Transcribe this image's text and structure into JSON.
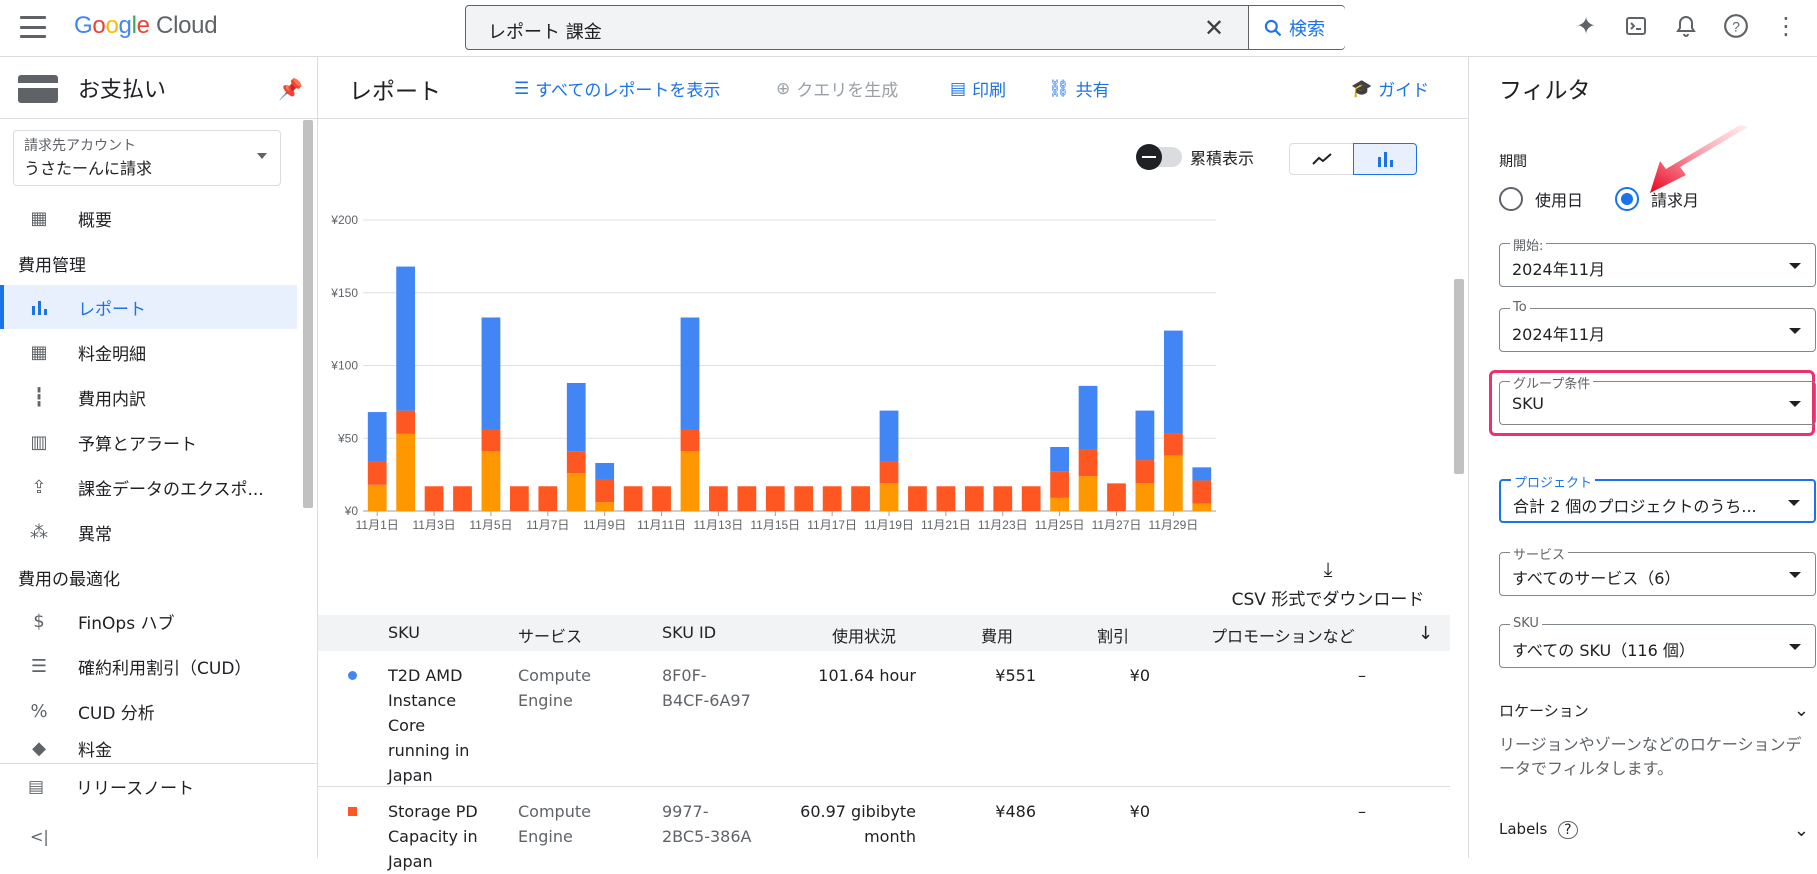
{
  "header": {
    "logo_google": "Google",
    "logo_cloud": "Cloud",
    "search_query": "レポート 課金",
    "search_button": "検索",
    "icons": [
      "gemini-icon",
      "terminal-icon",
      "bell-icon",
      "help-icon",
      "more-vert-icon"
    ]
  },
  "sidebar": {
    "title": "お支払い",
    "account_label": "請求先アカウント",
    "account_value": "うさたーんに請求",
    "items": [
      {
        "label": "概要",
        "icon": "dashboard-icon"
      },
      {
        "section": "費用管理"
      },
      {
        "label": "レポート",
        "icon": "bar-chart-icon",
        "active": true
      },
      {
        "label": "料金明細",
        "icon": "table-icon"
      },
      {
        "label": "費用内訳",
        "icon": "waterfall-icon"
      },
      {
        "label": "予算とアラート",
        "icon": "budget-icon"
      },
      {
        "label": "課金データのエクスポ...",
        "icon": "export-icon"
      },
      {
        "label": "異常",
        "icon": "anomaly-icon"
      },
      {
        "section": "費用の最適化"
      },
      {
        "label": "FinOps ハブ",
        "icon": "dollar-icon"
      },
      {
        "label": "確約利用割引（CUD）",
        "icon": "list-icon"
      },
      {
        "label": "CUD 分析",
        "icon": "percent-icon"
      },
      {
        "label": "料金",
        "icon": "tag-icon"
      }
    ],
    "footer": "リリースノート",
    "collapse": "<|"
  },
  "main": {
    "title": "レポート",
    "actions": {
      "all_reports": "すべてのレポートを表示",
      "query": "クエリを生成",
      "print": "印刷",
      "share": "共有",
      "guide": "ガイド"
    },
    "cumulative_label": "累積表示",
    "csv_label": "CSV 形式でダウンロード"
  },
  "chart_data": {
    "type": "bar",
    "stacked": true,
    "y_ticks": [
      "¥200",
      "¥150",
      "¥100",
      "¥50",
      "¥0"
    ],
    "ylim": [
      0,
      200
    ],
    "x_tick_labels": [
      "11月1日",
      "11月3日",
      "11月5日",
      "11月7日",
      "11月9日",
      "11月11日",
      "11月13日",
      "11月15日",
      "11月17日",
      "11月19日",
      "11月21日",
      "11月23日",
      "11月25日",
      "11月27日",
      "11月29日"
    ],
    "categories": [
      "1",
      "2",
      "3",
      "4",
      "5",
      "6",
      "7",
      "8",
      "9",
      "10",
      "11",
      "12",
      "13",
      "14",
      "15",
      "16",
      "17",
      "18",
      "19",
      "20",
      "21",
      "22",
      "23",
      "24",
      "25",
      "26",
      "27",
      "28",
      "29",
      "30"
    ],
    "colors": [
      "#ff9800",
      "#ff5722",
      "#4285f4"
    ],
    "series": [
      {
        "values": [
          18,
          53,
          0,
          0,
          41,
          0,
          0,
          26,
          6,
          0,
          0,
          41,
          0,
          0,
          0,
          0,
          0,
          0,
          19,
          0,
          0,
          0,
          0,
          0,
          9,
          24,
          0,
          19,
          38,
          5
        ]
      },
      {
        "values": [
          16,
          16,
          17,
          17,
          15,
          17,
          17,
          15,
          16,
          17,
          17,
          15,
          17,
          17,
          17,
          17,
          17,
          17,
          15,
          17,
          17,
          17,
          17,
          17,
          18,
          18,
          19,
          16,
          15,
          16
        ]
      },
      {
        "values": [
          34,
          99,
          0,
          0,
          77,
          0,
          0,
          47,
          11,
          0,
          0,
          77,
          0,
          0,
          0,
          0,
          0,
          0,
          35,
          0,
          0,
          0,
          0,
          0,
          17,
          44,
          0,
          34,
          71,
          9
        ]
      }
    ]
  },
  "table": {
    "columns": [
      "SKU",
      "サービス",
      "SKU ID",
      "使用状況",
      "費用",
      "割引",
      "プロモーションなど"
    ],
    "rows": [
      {
        "sku_lines": [
          "T2D AMD",
          "Instance",
          "Core",
          "running in",
          "Japan"
        ],
        "service_lines": [
          "Compute",
          "Engine"
        ],
        "id_lines": [
          "8F0F-",
          "B4CF-6A97"
        ],
        "usage_lines": [
          "101.64 hour"
        ],
        "cost": "¥551",
        "discount": "¥0",
        "promo": "–",
        "color": "#4285f4"
      },
      {
        "sku_lines": [
          "Storage PD",
          "Capacity in",
          "Japan"
        ],
        "service_lines": [
          "Compute",
          "Engine"
        ],
        "id_lines": [
          "9977-",
          "2BC5-386A"
        ],
        "usage_lines": [
          "60.97 gibibyte",
          "month"
        ],
        "cost": "¥486",
        "discount": "¥0",
        "promo": "–",
        "color": "#ff5722"
      }
    ]
  },
  "filters": {
    "title": "フィルタ",
    "period_label": "期間",
    "radio_usage": "使用日",
    "radio_invoice": "請求月",
    "start_label": "開始:",
    "start_value": "2024年11月",
    "to_label": "To",
    "to_value": "2024年11月",
    "group_label": "グループ条件",
    "group_value": "SKU",
    "project_label": "プロジェクト",
    "project_value": "合計 2 個のプロジェクトのうち...",
    "service_label": "サービス",
    "service_value": "すべてのサービス（6）",
    "sku_label": "SKU",
    "sku_value": "すべての SKU（116 個）",
    "location_title": "ロケーション",
    "location_desc": "リージョンやゾーンなどのロケーションデータでフィルタします。",
    "labels_title": "Labels"
  }
}
